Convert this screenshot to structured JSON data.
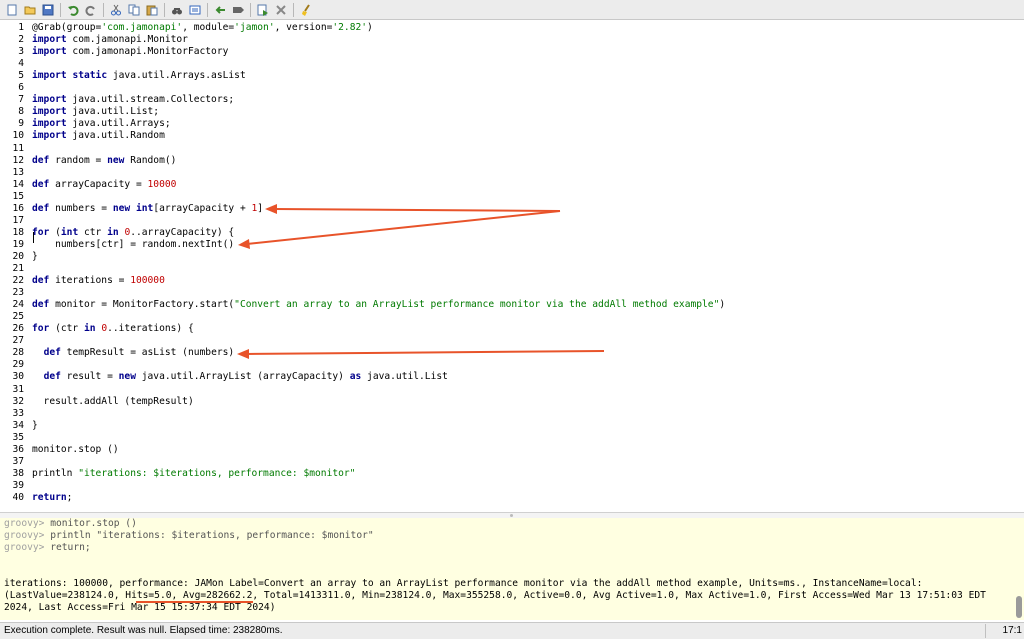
{
  "toolbar": {
    "buttons": [
      "new-file-icon",
      "open-file-icon",
      "save-file-icon",
      "undo-icon",
      "redo-icon",
      "cut-icon",
      "copy-icon",
      "paste-icon",
      "browse-icon",
      "history-icon",
      "previous-icon",
      "next-icon",
      "run-script-icon",
      "interrupt-icon",
      "clear-output-icon"
    ]
  },
  "editor": {
    "lines": [
      {
        "n": "1",
        "t": [
          {
            "x": "@Grab(group="
          },
          {
            "x": "'com.jamonapi'",
            "c": "str"
          },
          {
            "x": ", module="
          },
          {
            "x": "'jamon'",
            "c": "str"
          },
          {
            "x": ", version="
          },
          {
            "x": "'2.82'",
            "c": "str"
          },
          {
            "x": ")"
          }
        ]
      },
      {
        "n": "2",
        "t": [
          {
            "x": "import",
            "c": "kw"
          },
          {
            "x": " com.jamonapi.Monitor"
          }
        ]
      },
      {
        "n": "3",
        "t": [
          {
            "x": "import",
            "c": "kw"
          },
          {
            "x": " com.jamonapi.MonitorFactory"
          }
        ]
      },
      {
        "n": "4",
        "t": []
      },
      {
        "n": "5",
        "t": [
          {
            "x": "import",
            "c": "kw"
          },
          {
            "x": " "
          },
          {
            "x": "static",
            "c": "kw"
          },
          {
            "x": " java.util.Arrays.asList"
          }
        ]
      },
      {
        "n": "6",
        "t": []
      },
      {
        "n": "7",
        "t": [
          {
            "x": "import",
            "c": "kw"
          },
          {
            "x": " java.util.stream.Collectors;"
          }
        ]
      },
      {
        "n": "8",
        "t": [
          {
            "x": "import",
            "c": "kw"
          },
          {
            "x": " java.util.List;"
          }
        ]
      },
      {
        "n": "9",
        "t": [
          {
            "x": "import",
            "c": "kw"
          },
          {
            "x": " java.util.Arrays;"
          }
        ]
      },
      {
        "n": "10",
        "t": [
          {
            "x": "import",
            "c": "kw"
          },
          {
            "x": " java.util.Random"
          }
        ]
      },
      {
        "n": "11",
        "t": []
      },
      {
        "n": "12",
        "t": [
          {
            "x": "def",
            "c": "kw"
          },
          {
            "x": " random = "
          },
          {
            "x": "new",
            "c": "kw"
          },
          {
            "x": " Random()"
          }
        ]
      },
      {
        "n": "13",
        "t": []
      },
      {
        "n": "14",
        "t": [
          {
            "x": "def",
            "c": "kw"
          },
          {
            "x": " arrayCapacity = "
          },
          {
            "x": "10000",
            "c": "num"
          }
        ]
      },
      {
        "n": "15",
        "t": []
      },
      {
        "n": "16",
        "t": [
          {
            "x": "def",
            "c": "kw"
          },
          {
            "x": " numbers = "
          },
          {
            "x": "new",
            "c": "kw"
          },
          {
            "x": " "
          },
          {
            "x": "int",
            "c": "kw"
          },
          {
            "x": "[arrayCapacity + "
          },
          {
            "x": "1",
            "c": "num"
          },
          {
            "x": "]"
          }
        ]
      },
      {
        "n": "17",
        "t": []
      },
      {
        "n": "18",
        "t": [
          {
            "x": "for",
            "c": "kw"
          },
          {
            "x": " ("
          },
          {
            "x": "int",
            "c": "kw"
          },
          {
            "x": " ctr "
          },
          {
            "x": "in",
            "c": "kw"
          },
          {
            "x": " "
          },
          {
            "x": "0",
            "c": "num"
          },
          {
            "x": "..arrayCapacity) {"
          }
        ]
      },
      {
        "n": "19",
        "t": [
          {
            "x": "    numbers[ctr] = random.nextInt()"
          }
        ]
      },
      {
        "n": "20",
        "t": [
          {
            "x": "}"
          }
        ]
      },
      {
        "n": "21",
        "t": []
      },
      {
        "n": "22",
        "t": [
          {
            "x": "def",
            "c": "kw"
          },
          {
            "x": " iterations = "
          },
          {
            "x": "100000",
            "c": "num"
          }
        ]
      },
      {
        "n": "23",
        "t": []
      },
      {
        "n": "24",
        "t": [
          {
            "x": "def",
            "c": "kw"
          },
          {
            "x": " monitor = MonitorFactory.start("
          },
          {
            "x": "\"Convert an array to an ArrayList performance monitor via the addAll method example\"",
            "c": "str"
          },
          {
            "x": ")"
          }
        ]
      },
      {
        "n": "25",
        "t": []
      },
      {
        "n": "26",
        "t": [
          {
            "x": "for",
            "c": "kw"
          },
          {
            "x": " (ctr "
          },
          {
            "x": "in",
            "c": "kw"
          },
          {
            "x": " "
          },
          {
            "x": "0",
            "c": "num"
          },
          {
            "x": "..iterations) {"
          }
        ]
      },
      {
        "n": "27",
        "t": []
      },
      {
        "n": "28",
        "t": [
          {
            "x": "  "
          },
          {
            "x": "def",
            "c": "kw"
          },
          {
            "x": " tempResult = asList (numbers)"
          }
        ]
      },
      {
        "n": "29",
        "t": []
      },
      {
        "n": "30",
        "t": [
          {
            "x": "  "
          },
          {
            "x": "def",
            "c": "kw"
          },
          {
            "x": " result = "
          },
          {
            "x": "new",
            "c": "kw"
          },
          {
            "x": " java.util.ArrayList (arrayCapacity) "
          },
          {
            "x": "as",
            "c": "kw"
          },
          {
            "x": " java.util.List"
          }
        ]
      },
      {
        "n": "31",
        "t": []
      },
      {
        "n": "32",
        "t": [
          {
            "x": "  result.addAll (tempResult)"
          }
        ]
      },
      {
        "n": "33",
        "t": []
      },
      {
        "n": "34",
        "t": [
          {
            "x": "}"
          }
        ]
      },
      {
        "n": "35",
        "t": []
      },
      {
        "n": "36",
        "t": [
          {
            "x": "monitor.stop ()"
          }
        ]
      },
      {
        "n": "37",
        "t": []
      },
      {
        "n": "38",
        "t": [
          {
            "x": "println "
          },
          {
            "x": "\"iterations: $iterations, performance: $monitor\"",
            "c": "str"
          }
        ]
      },
      {
        "n": "39",
        "t": []
      },
      {
        "n": "40",
        "t": [
          {
            "x": "return",
            "c": "kw"
          },
          {
            "x": ";"
          }
        ]
      }
    ]
  },
  "console": {
    "history": [
      {
        "prompt": "groovy>",
        "text": " monitor.stop ()"
      },
      {
        "prompt": "groovy>",
        "text": " println \"iterations: $iterations, performance: $monitor\""
      },
      {
        "prompt": "groovy>",
        "text": " return;"
      }
    ],
    "output": [
      "iterations: 100000, performance: JAMon Label=Convert an array to an ArrayList performance monitor via the addAll method example, Units=ms., InstanceName=local:",
      "(LastValue=238124.0, Hits=5.0, Avg=282662.2, Total=1413311.0, Min=238124.0, Max=355258.0, Active=0.0, Avg Active=1.0, Max Active=1.0, First Access=Wed Mar 13 17:51:03 EDT",
      "2024, Last Access=Fri Mar 15 15:37:34 EDT 2024)"
    ]
  },
  "status": {
    "message": "Execution complete. Result was null. Elapsed time: 238280ms.",
    "position": "17:1"
  },
  "colors": {
    "annotation": "#e8532a",
    "console_bg": "#ffffe1"
  }
}
